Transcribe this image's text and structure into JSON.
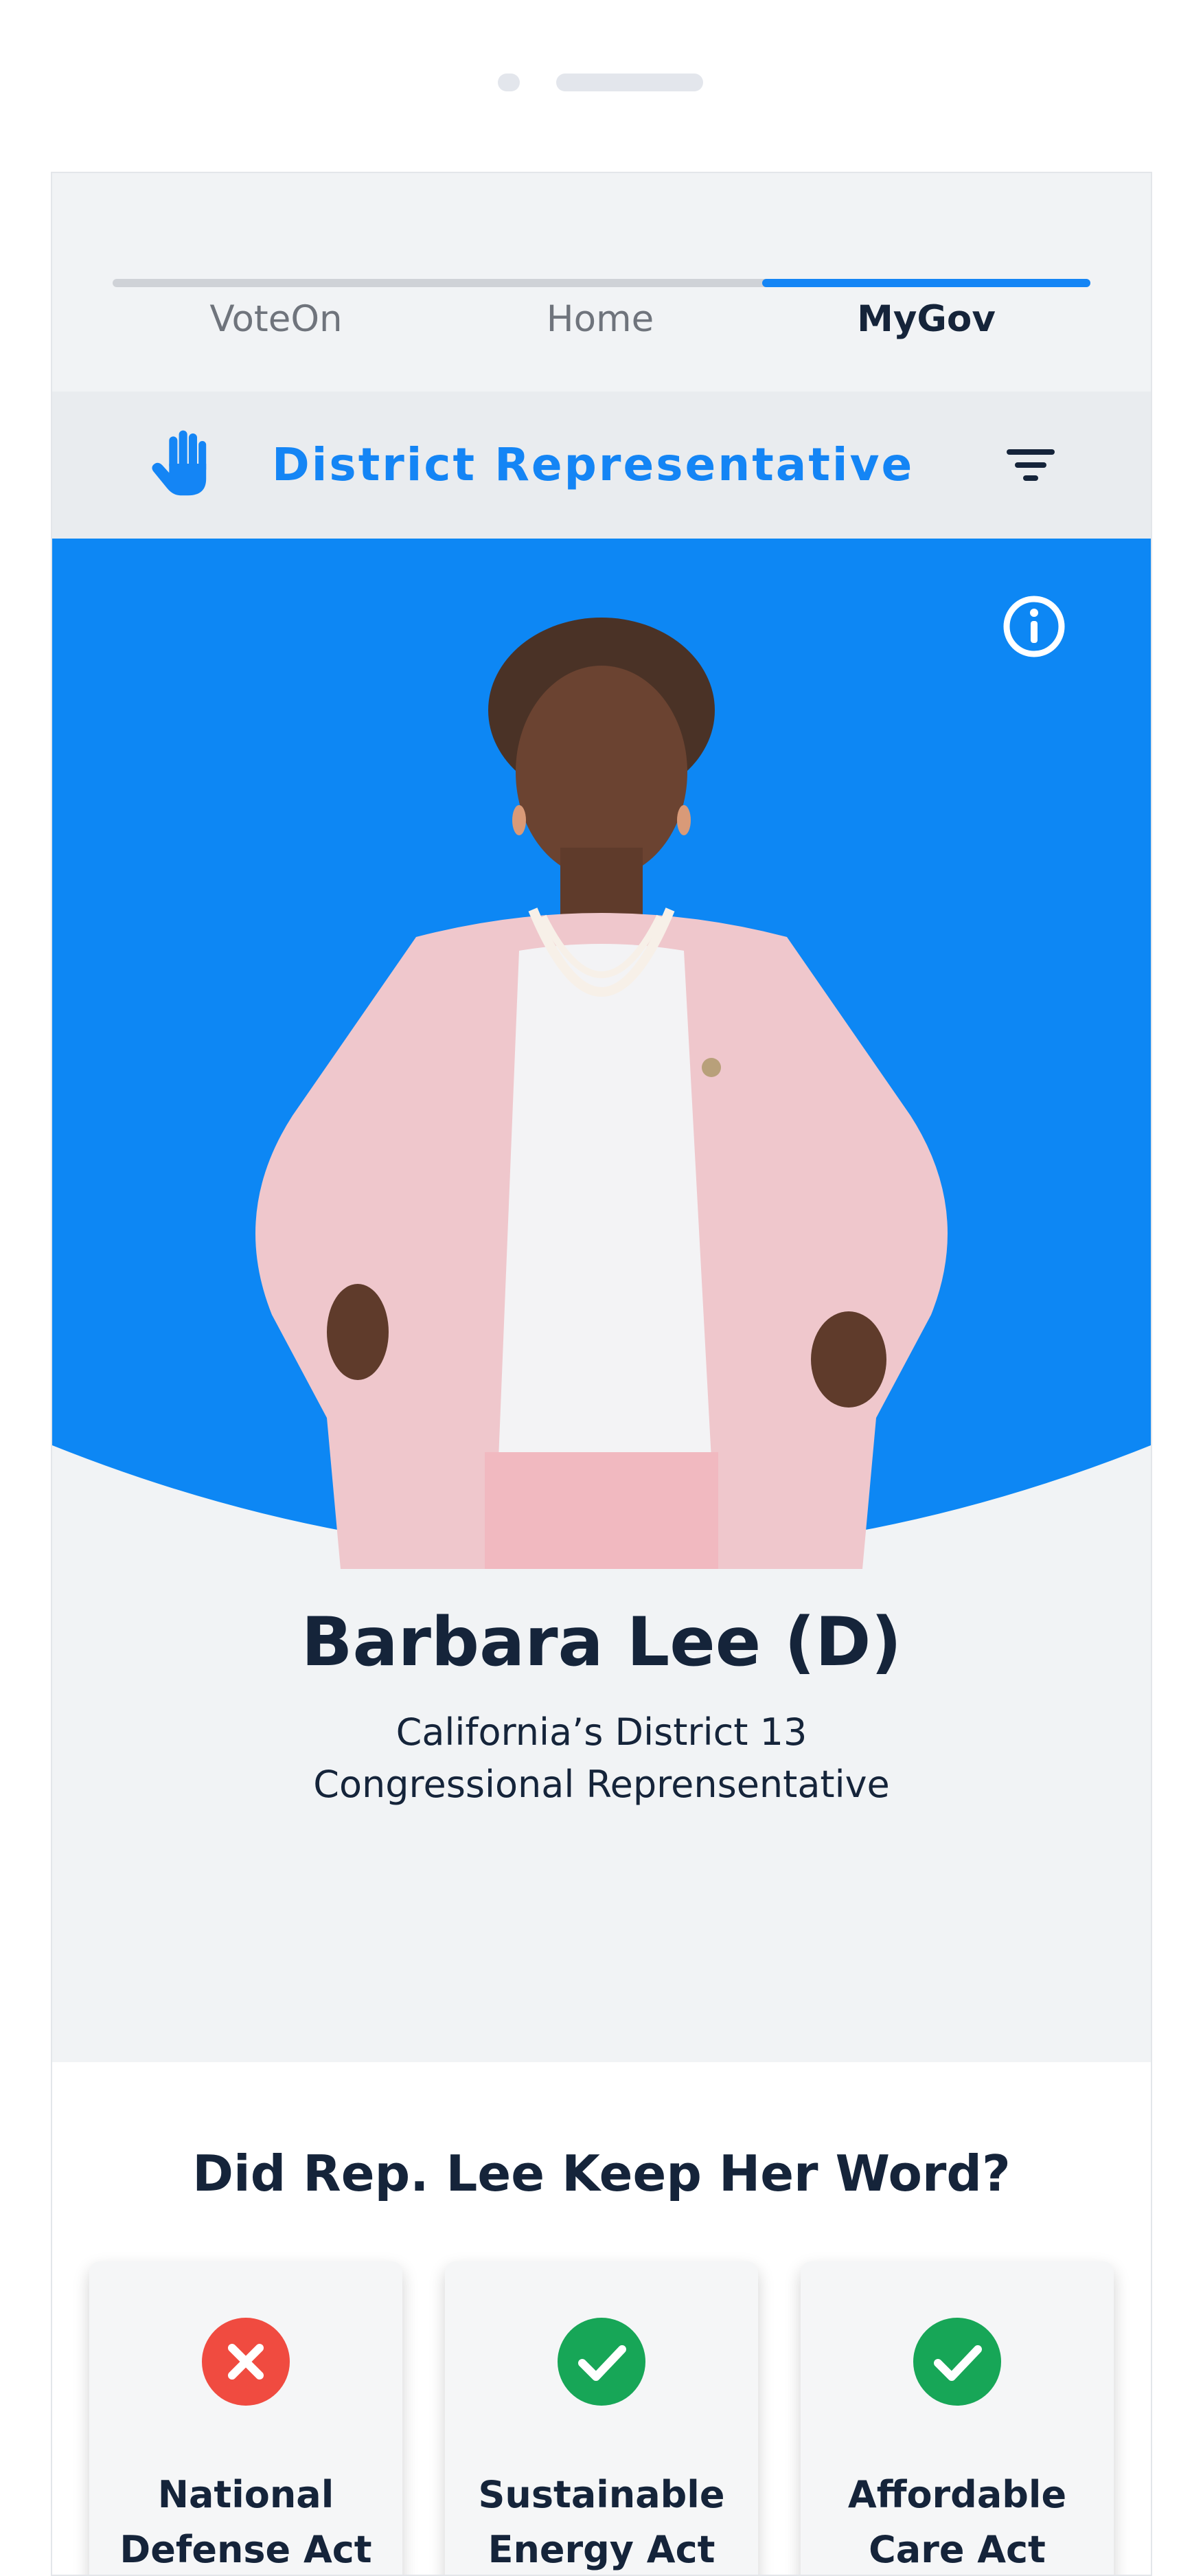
{
  "tabs": [
    {
      "label": "VoteOn",
      "active": false
    },
    {
      "label": "Home",
      "active": false
    },
    {
      "label": "MyGov",
      "active": true
    }
  ],
  "header": {
    "left_icon": "raised-hand-icon",
    "title": "District Representative",
    "right_icon": "filter-icon"
  },
  "hero": {
    "info_icon": "info-icon",
    "image": "representative-portrait"
  },
  "representative": {
    "name": "Barbara Lee (D)",
    "district": "California’s District 13",
    "role": "Congressional Reprensentative"
  },
  "votes": {
    "title": "Did Rep. Lee Keep Her Word?",
    "items": [
      {
        "line1": "National",
        "line2": "Defense Act",
        "status": "broken",
        "icon": "x-circle-icon"
      },
      {
        "line1": "Sustainable",
        "line2": "Energy Act",
        "status": "kept",
        "icon": "check-circle-icon"
      },
      {
        "line1": "Affordable",
        "line2": "Care Act",
        "status": "kept",
        "icon": "check-circle-icon"
      }
    ]
  },
  "colors": {
    "accent": "#1485f5",
    "hero_bg": "#0d87f4",
    "text_dark": "#15243a",
    "broken": "#f04b40",
    "kept": "#17a657",
    "background": "#f1f3f5"
  }
}
